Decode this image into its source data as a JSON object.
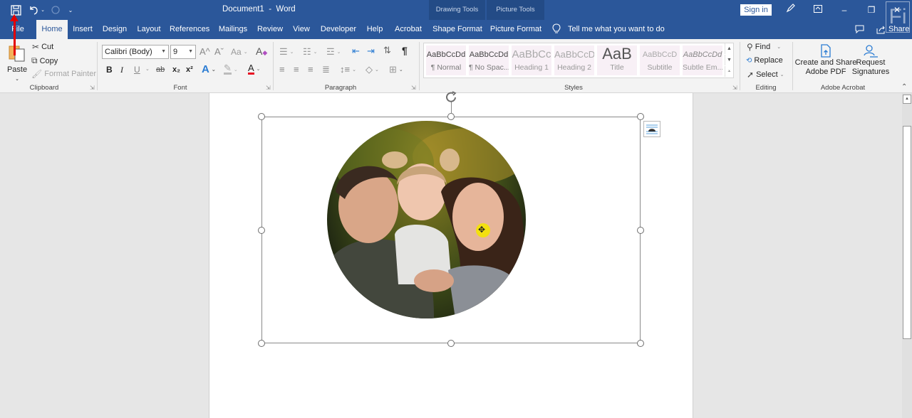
{
  "window": {
    "title": "Document1  -  Word",
    "sign_in": "Sign in",
    "context_groups": [
      {
        "label": "Drawing Tools"
      },
      {
        "label": "Picture Tools"
      }
    ],
    "controls": {
      "minimize": "–",
      "restore": "❐",
      "close": "✕"
    }
  },
  "qat": {
    "save": "save-icon",
    "undo": "undo-icon",
    "redo": "redo-icon",
    "customize": "customize-qat-icon"
  },
  "tabs": [
    {
      "label": "File"
    },
    {
      "label": "Home",
      "active": true
    },
    {
      "label": "Insert"
    },
    {
      "label": "Design"
    },
    {
      "label": "Layout"
    },
    {
      "label": "References"
    },
    {
      "label": "Mailings"
    },
    {
      "label": "Review"
    },
    {
      "label": "View"
    },
    {
      "label": "Developer"
    },
    {
      "label": "Help"
    },
    {
      "label": "Acrobat"
    },
    {
      "label": "Shape Format"
    },
    {
      "label": "Picture Format"
    }
  ],
  "tell_me": "Tell me what you want to do",
  "share": "Share",
  "ribbon": {
    "clipboard": {
      "label": "Clipboard",
      "paste": "Paste",
      "cut": "Cut",
      "copy": "Copy",
      "format_painter": "Format Painter"
    },
    "font": {
      "label": "Font",
      "font_name": "Calibri (Body)",
      "font_size": "9",
      "bold": "B",
      "italic": "I",
      "underline": "U",
      "strike": "ab",
      "subscript": "x₂",
      "superscript": "x²",
      "grow": "A^",
      "shrink": "Aˇ",
      "change_case": "Aa",
      "font_color_hex": "#e81123"
    },
    "paragraph": {
      "label": "Paragraph"
    },
    "styles": {
      "label": "Styles",
      "items": [
        {
          "preview": "AaBbCcDd",
          "name": "¶ Normal"
        },
        {
          "preview": "AaBbCcDd",
          "name": "¶ No Spac..."
        },
        {
          "preview": "AaBbCc",
          "name": "Heading 1"
        },
        {
          "preview": "AaBbCcD",
          "name": "Heading 2"
        },
        {
          "preview": "AaB",
          "name": "Title"
        },
        {
          "preview": "AaBbCcD",
          "name": "Subtitle"
        },
        {
          "preview": "AaBbCcDd",
          "name": "Subtle Em..."
        }
      ]
    },
    "editing": {
      "label": "Editing",
      "find": "Find",
      "replace": "Replace",
      "select": "Select"
    },
    "acrobat": {
      "label": "Adobe Acrobat",
      "create_share_line1": "Create and Share",
      "create_share_line2": "Adobe PDF",
      "request_line1": "Request",
      "request_line2": "Signatures"
    }
  },
  "document": {
    "image_description": "Circular-cropped family photo: man, toddler girl with pigtails, and woman smiling outdoors",
    "layout_options_icon": "layout-options-icon"
  },
  "colors": {
    "brand": "#2b579a",
    "context_tab": "#234b86",
    "ribbon_bg": "#f3f3f3",
    "canvas_bg": "#e6e6e6",
    "cursor_highlight": "#f3e00f"
  }
}
